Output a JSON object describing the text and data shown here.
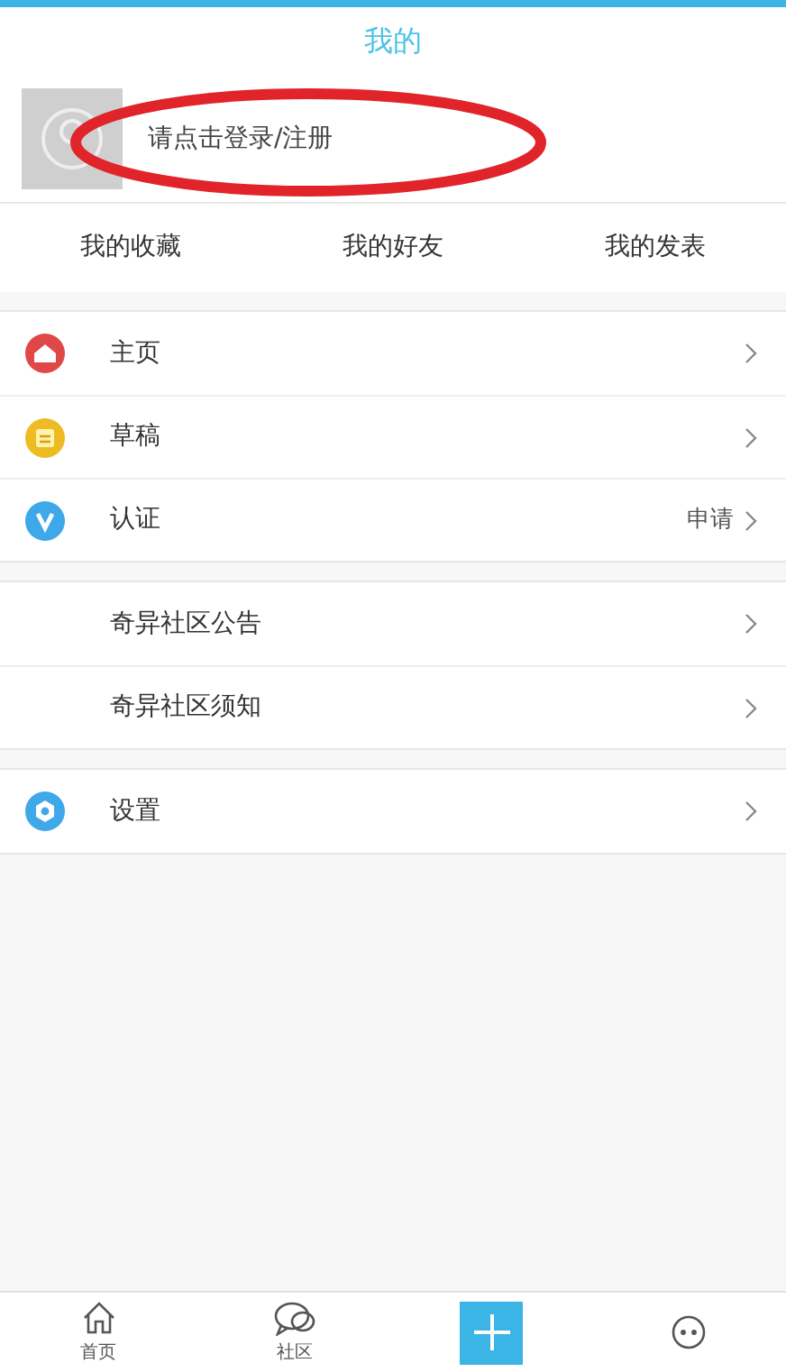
{
  "header": {
    "title": "我的"
  },
  "profile": {
    "login_text": "请点击登录/注册"
  },
  "tabs": [
    {
      "label": "我的收藏"
    },
    {
      "label": "我的好友"
    },
    {
      "label": "我的发表"
    }
  ],
  "sections": [
    {
      "items": [
        {
          "kind": "home",
          "label": "主页"
        },
        {
          "kind": "draft",
          "label": "草稿"
        },
        {
          "kind": "verify",
          "label": "认证",
          "value": "申请"
        }
      ]
    },
    {
      "items": [
        {
          "kind": "plain",
          "label": "奇异社区公告"
        },
        {
          "kind": "plain",
          "label": "奇异社区须知"
        }
      ]
    },
    {
      "items": [
        {
          "kind": "settings",
          "label": "设置"
        }
      ]
    }
  ],
  "bottom_nav": [
    {
      "kind": "home",
      "label": "首页"
    },
    {
      "kind": "community",
      "label": "社区"
    },
    {
      "kind": "add"
    },
    {
      "kind": "message"
    }
  ]
}
